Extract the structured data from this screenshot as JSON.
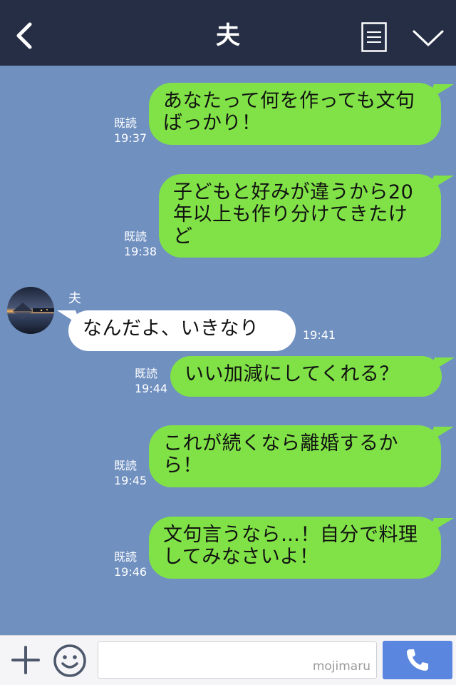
{
  "header": {
    "title": "夫"
  },
  "messages": [
    {
      "direction": "out",
      "read_label": "既読",
      "time": "19:37",
      "text": "あなたって何を作っても文句ばっかり！"
    },
    {
      "direction": "out",
      "read_label": "既読",
      "time": "19:38",
      "text": "子どもと好みが違うから20年以上も作り分けてきたけど"
    },
    {
      "direction": "in",
      "sender": "夫",
      "time": "19:41",
      "text": "なんだよ、いきなり"
    },
    {
      "direction": "out",
      "read_label": "既読",
      "time": "19:44",
      "text": "いい加減にしてくれる？"
    },
    {
      "direction": "out",
      "read_label": "既読",
      "time": "19:45",
      "text": "これが続くなら離婚するから！"
    },
    {
      "direction": "out",
      "read_label": "既読",
      "time": "19:46",
      "text": "文句言うなら…！自分で料理してみなさいよ！"
    }
  ],
  "composer": {
    "input_value": "",
    "watermark": "mojimaru"
  },
  "colors": {
    "header_bg": "#252e45",
    "chat_bg": "#7090c0",
    "outgoing_bubble": "#80e247",
    "incoming_bubble": "#ffffff",
    "call_button": "#5a86e0"
  },
  "icons": {
    "back": "chevron-left-icon",
    "notes": "notes-icon",
    "menu": "chevron-down-icon",
    "add": "plus-icon",
    "emoji": "smiley-icon",
    "call": "phone-icon"
  }
}
